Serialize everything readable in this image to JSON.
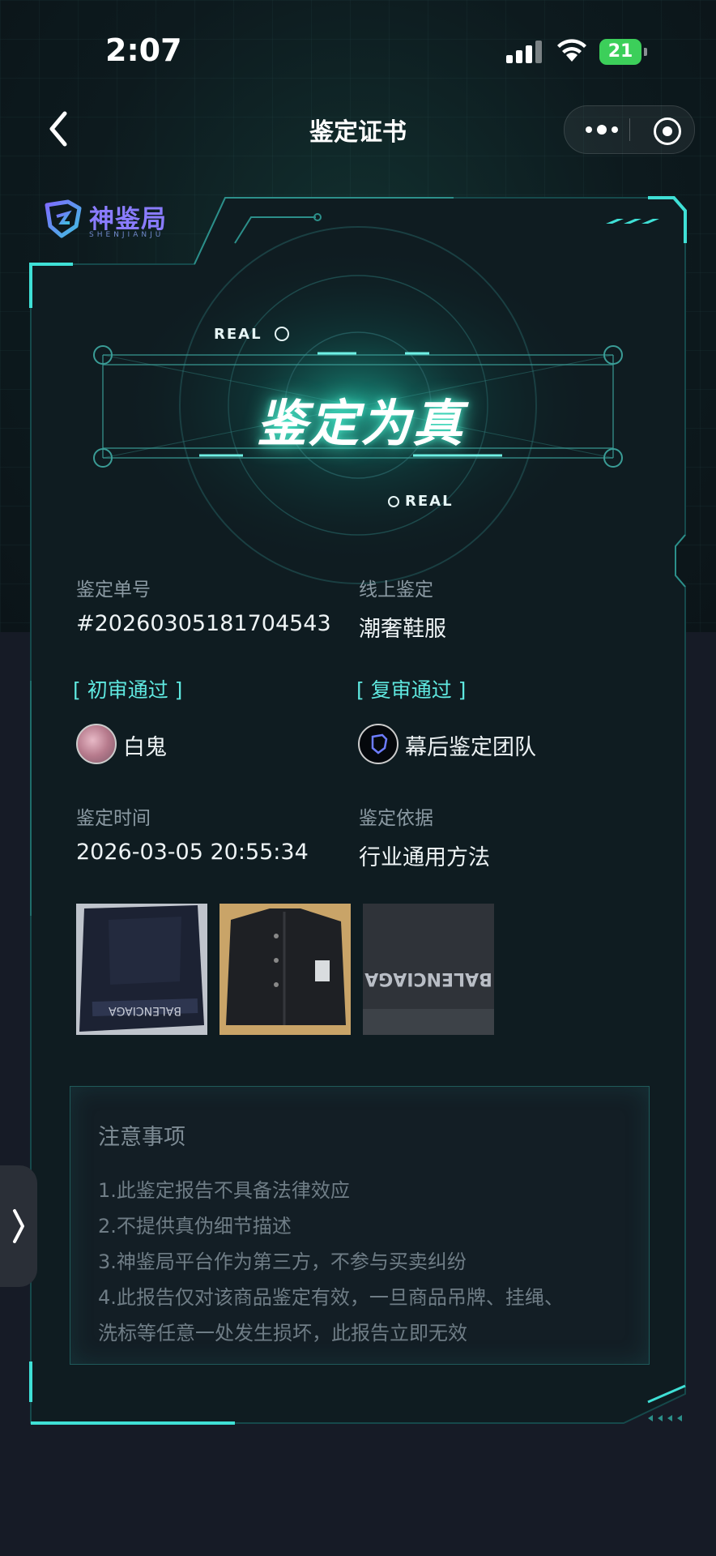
{
  "status": {
    "time": "2:07",
    "battery": "21"
  },
  "nav": {
    "title": "鉴定证书"
  },
  "brand": {
    "name": "神鉴局",
    "sub": "SHENJIANJU"
  },
  "hero": {
    "title": "鉴定为真",
    "tag_top": "REAL",
    "tag_bottom": "REAL"
  },
  "info": {
    "order_label": "鉴定单号",
    "order_value": "#20260305181704543",
    "type_label": "线上鉴定",
    "type_value": "潮奢鞋服",
    "first_review": "初审通过",
    "first_reviewer": "白鬼",
    "second_review": "复审通过",
    "second_reviewer": "幕后鉴定团队",
    "time_label": "鉴定时间",
    "time_value": "2026-03-05 20:55:34",
    "basis_label": "鉴定依据",
    "basis_value": "行业通用方法"
  },
  "photos": [
    {
      "name": "jacket-back-photo",
      "text": "BALENCIAGA"
    },
    {
      "name": "jacket-front-photo",
      "text": ""
    },
    {
      "name": "jacket-logo-photo",
      "text": "BALENCIAGA"
    }
  ],
  "notice": {
    "title": "注意事项",
    "lines": [
      "1.此鉴定报告不具备法律效应",
      "2.不提供真伪细节描述",
      "3.神鉴局平台作为第三方，不参与买卖纠纷",
      "4.此报告仅对该商品鉴定有效，一旦商品吊牌、挂绳、",
      "洗标等任意一处发生损坏，此报告立即无效"
    ]
  },
  "colors": {
    "accent": "#3fe0d6",
    "panel": "#0f1d22"
  }
}
